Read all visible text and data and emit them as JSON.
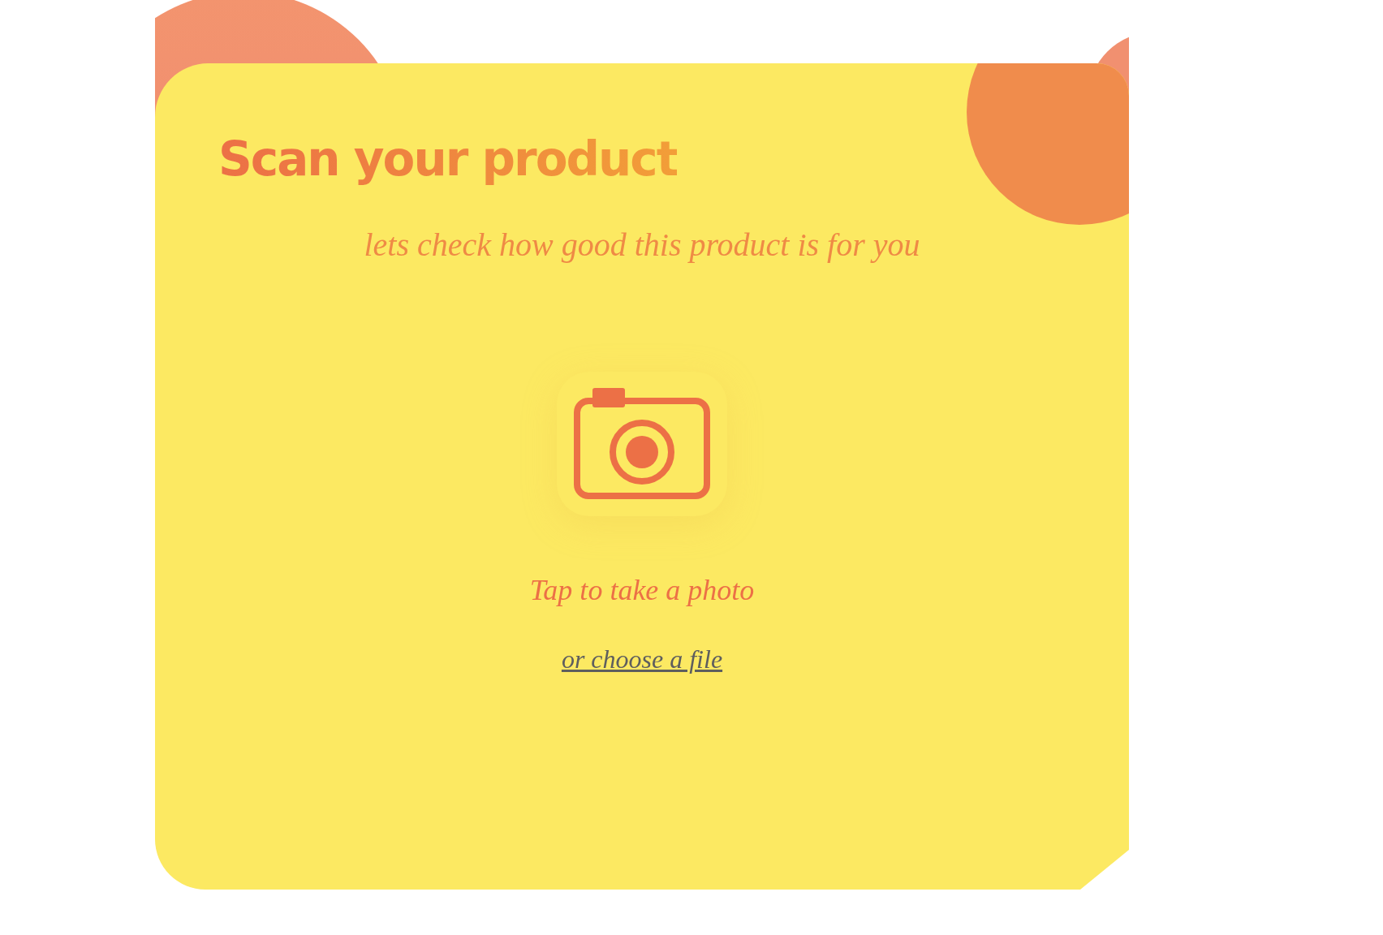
{
  "card": {
    "title": "Scan your product",
    "subtitle": "lets check how good this product is for you",
    "capture_label": "Tap to take a photo",
    "file_link": "or choose a file"
  }
}
